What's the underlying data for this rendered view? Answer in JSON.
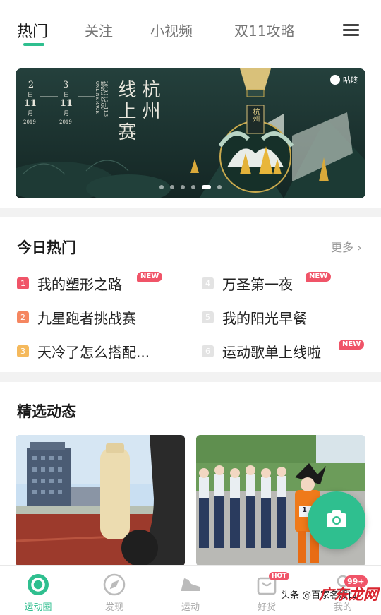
{
  "tabs": [
    {
      "label": "热门"
    },
    {
      "label": "关注"
    },
    {
      "label": "小视频"
    },
    {
      "label": "双11攻略"
    }
  ],
  "banner": {
    "badge": "咕咚",
    "dates": [
      {
        "top": "2",
        "day": "日",
        "month": "11",
        "unit": "月",
        "year": "2019"
      },
      {
        "top": "3",
        "day": "日",
        "month": "11",
        "unit": "月",
        "year": "2019"
      }
    ],
    "title_col1": "杭州",
    "title_col2": "线上赛",
    "subtitle": "HANG ZHOU ONLINE RACE",
    "date_range": "2019.11.2—11.3",
    "medal_text": "杭州",
    "dots_count": 6,
    "active_dot": 4
  },
  "hot": {
    "title": "今日热门",
    "more": "更多",
    "items": [
      {
        "rank": "1",
        "label": "我的塑形之路",
        "tag": "NEW",
        "color": "#f05468"
      },
      {
        "rank": "4",
        "label": "万圣第一夜",
        "tag": "NEW",
        "color": "#e3e3e3"
      },
      {
        "rank": "2",
        "label": "九星跑者挑战赛",
        "tag": "",
        "color": "#f58660"
      },
      {
        "rank": "5",
        "label": "我的阳光早餐",
        "tag": "",
        "color": "#e3e3e3"
      },
      {
        "rank": "3",
        "label": "天冷了怎么搭配...",
        "tag": "",
        "color": "#f5b95c"
      },
      {
        "rank": "6",
        "label": "运动歌单上线啦",
        "tag": "NEW",
        "color": "#e3e3e3"
      }
    ]
  },
  "feed": {
    "title": "精选动态",
    "bib_number": "1"
  },
  "nav": [
    {
      "label": "运动圈"
    },
    {
      "label": "发现"
    },
    {
      "label": "运动"
    },
    {
      "label": "好货",
      "badge": "HOT"
    },
    {
      "label": "我的",
      "badge": "99+"
    }
  ],
  "watermark": {
    "text": "头条 @百家名媛白",
    "logo": "广东龙网"
  },
  "colors": {
    "accent": "#2fbf8f",
    "badge": "#f05468"
  }
}
